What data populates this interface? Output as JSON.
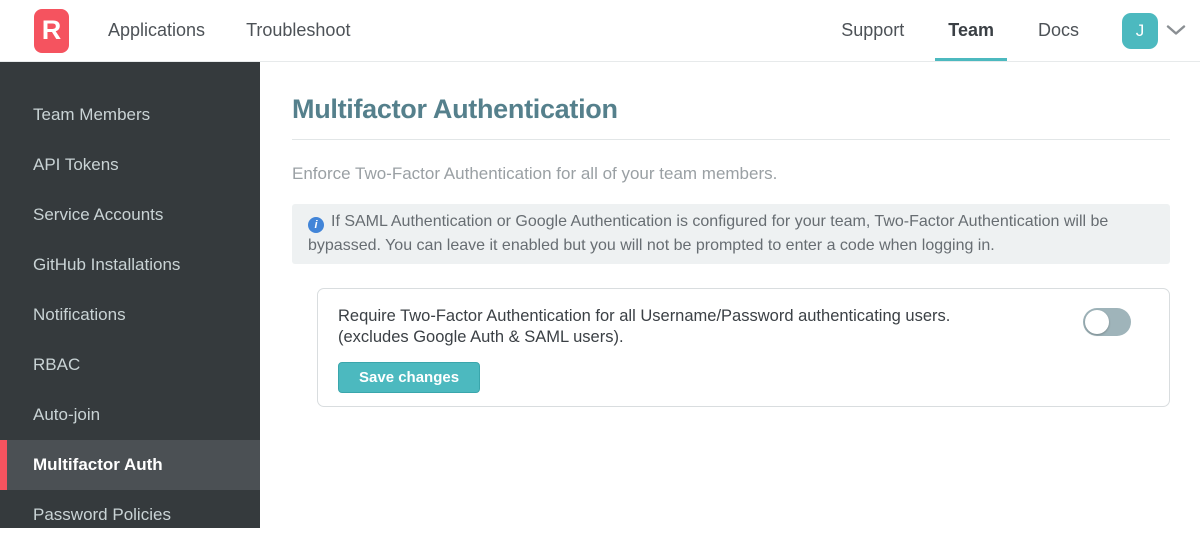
{
  "header": {
    "logo_letter": "R",
    "left_nav": {
      "applications": "Applications",
      "troubleshoot": "Troubleshoot"
    },
    "right_nav": {
      "support": "Support",
      "team": "Team",
      "docs": "Docs"
    },
    "active_tab": "Team",
    "avatar_initial": "J"
  },
  "sidebar": {
    "items": [
      {
        "label": "Team Members",
        "active": false
      },
      {
        "label": "API Tokens",
        "active": false
      },
      {
        "label": "Service Accounts",
        "active": false
      },
      {
        "label": "GitHub Installations",
        "active": false
      },
      {
        "label": "Notifications",
        "active": false
      },
      {
        "label": "RBAC",
        "active": false
      },
      {
        "label": "Auto-join",
        "active": false
      },
      {
        "label": "Multifactor Auth",
        "active": true
      },
      {
        "label": "Password Policies",
        "active": false
      }
    ]
  },
  "main": {
    "title": "Multifactor Authentication",
    "subtitle": "Enforce Two-Factor Authentication for all of your team members.",
    "info_icon_glyph": "i",
    "info_note": "If SAML Authentication or Google Authentication is configured for your team, Two-Factor Authentication will be bypassed. You can leave it enabled but you will not be prompted to enter a code when logging in.",
    "setting": {
      "label_line1": "Require Two-Factor Authentication for all Username/Password authenticating users.",
      "label_line2": "(excludes Google Auth & SAML users).",
      "toggle_state": "off",
      "save_label": "Save changes"
    }
  },
  "colors": {
    "brand_red": "#f5535f",
    "accent_teal": "#4cb9bf",
    "heading_teal": "#55808c",
    "info_icon_blue": "#4285d8",
    "toggle_track_off": "#9fb4ba",
    "sidebar_bg": "#353a3d",
    "sidebar_active_bg": "#4b5054"
  }
}
